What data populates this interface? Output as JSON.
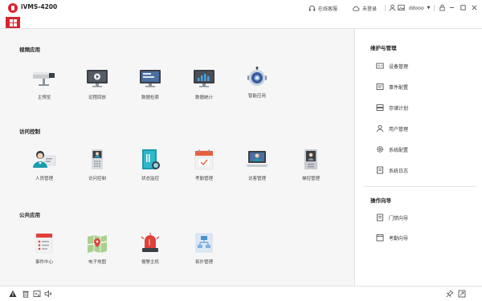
{
  "window": {
    "title": "iVMS-4200",
    "online_service": "在线客服",
    "login_status": "未登录",
    "username": "ddooo"
  },
  "sections": [
    {
      "title": "视频应用",
      "items": [
        {
          "label": "主预览",
          "icon": "surveillance-camera-icon"
        },
        {
          "label": "远程回放",
          "icon": "playback-monitor-icon"
        },
        {
          "label": "数据检索",
          "icon": "search-monitor-icon"
        },
        {
          "label": "数据统计",
          "icon": "statistics-monitor-icon"
        },
        {
          "label": "智能应用",
          "icon": "robot-icon"
        }
      ]
    },
    {
      "title": "访问控制",
      "items": [
        {
          "label": "人员管理",
          "icon": "person-card-icon"
        },
        {
          "label": "访问控制",
          "icon": "access-terminal-icon"
        },
        {
          "label": "状态监控",
          "icon": "door-status-icon"
        },
        {
          "label": "考勤管理",
          "icon": "attendance-calendar-icon"
        },
        {
          "label": "访客管理",
          "icon": "visitor-laptop-icon"
        },
        {
          "label": "梯控管理",
          "icon": "elevator-terminal-icon"
        }
      ]
    },
    {
      "title": "公共应用",
      "items": [
        {
          "label": "事件中心",
          "icon": "event-list-icon"
        },
        {
          "label": "电子地图",
          "icon": "map-icon"
        },
        {
          "label": "报警主机",
          "icon": "alarm-siren-icon"
        },
        {
          "label": "拓扑管理",
          "icon": "topology-icon"
        }
      ]
    }
  ],
  "maintenance": {
    "title": "维护与管理",
    "items": [
      {
        "label": "设备管理",
        "icon": "device-icon"
      },
      {
        "label": "事件配置",
        "icon": "event-config-icon"
      },
      {
        "label": "存储计划",
        "icon": "storage-icon"
      },
      {
        "label": "用户管理",
        "icon": "user-icon"
      },
      {
        "label": "系统配置",
        "icon": "settings-icon"
      },
      {
        "label": "系统日志",
        "icon": "log-icon"
      }
    ]
  },
  "wizard": {
    "title": "操作向导",
    "items": [
      {
        "label": "门禁向导",
        "icon": "guide-icon"
      },
      {
        "label": "考勤向导",
        "icon": "attendance-guide-icon"
      }
    ]
  },
  "colors": {
    "accent": "#d7262f",
    "main_bg": "#f6f6f6",
    "dark_icon": "#3a3f47",
    "teal": "#1a9bb0"
  }
}
